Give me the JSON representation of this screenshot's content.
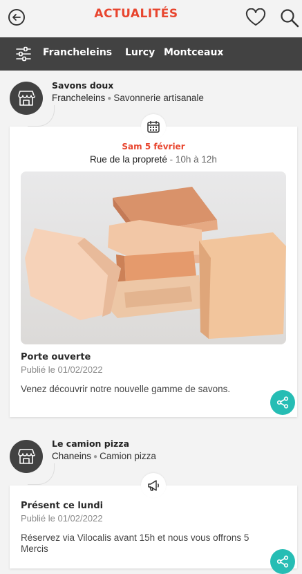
{
  "header": {
    "title": "ACTUALITÉS"
  },
  "filters": [
    "Francheleins",
    "Lurcy",
    "Montceaux"
  ],
  "posts": [
    {
      "pro_name": "Savons doux",
      "town": "Francheleins",
      "category": "Savonnerie artisanale",
      "date": "Sam 5 février",
      "place": "Rue de la propreté",
      "hours": " - 10h à 12h",
      "event_title": "Porte ouverte",
      "published": "Publié le 01/02/2022",
      "description": "Venez découvrir notre nouvelle gamme de savons."
    },
    {
      "pro_name": "Le camion pizza",
      "town": "Chaneins",
      "category": "Camion pizza",
      "event_title": "Présent ce lundi",
      "published": "Publié le 01/02/2022",
      "description": "Réservez via Vilocalis avant 15h et nous vous offrons 5 Mercis"
    }
  ],
  "icons": {
    "back": "arrow-left-circle-icon",
    "favorites": "heart-icon",
    "search": "search-icon",
    "filter": "sliders-icon",
    "shop": "shop-icon",
    "calendar": "calendar-icon",
    "announce": "megaphone-icon",
    "share": "share-icon"
  },
  "colors": {
    "accent": "#e8452e",
    "bar": "#424242",
    "share": "#26bdb4"
  }
}
